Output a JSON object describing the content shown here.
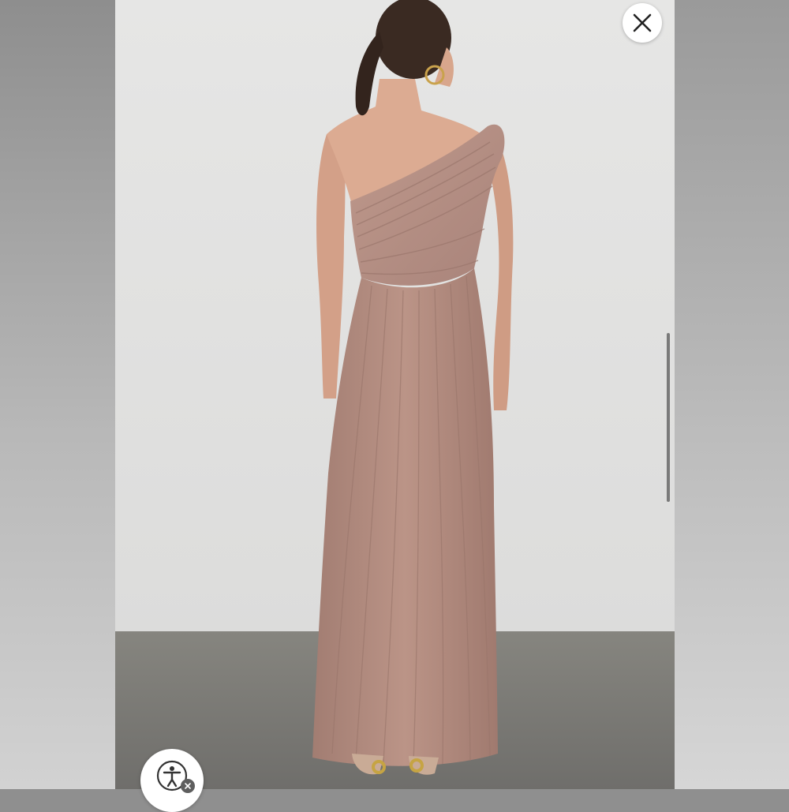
{
  "viewer": {
    "close_icon": "close-icon",
    "accessibility_icon": "accessibility-person-icon",
    "accessibility_dismiss_icon": "close-badge-icon"
  },
  "photo": {
    "subject": "product-photo",
    "colors": {
      "wall": "#e3e3e2",
      "floor": "#7d7c7a",
      "dress": "#b48f84",
      "skin": "#d9a58b",
      "hair": "#3a2a22"
    }
  },
  "scroll": {
    "position_fraction": 0.42
  }
}
